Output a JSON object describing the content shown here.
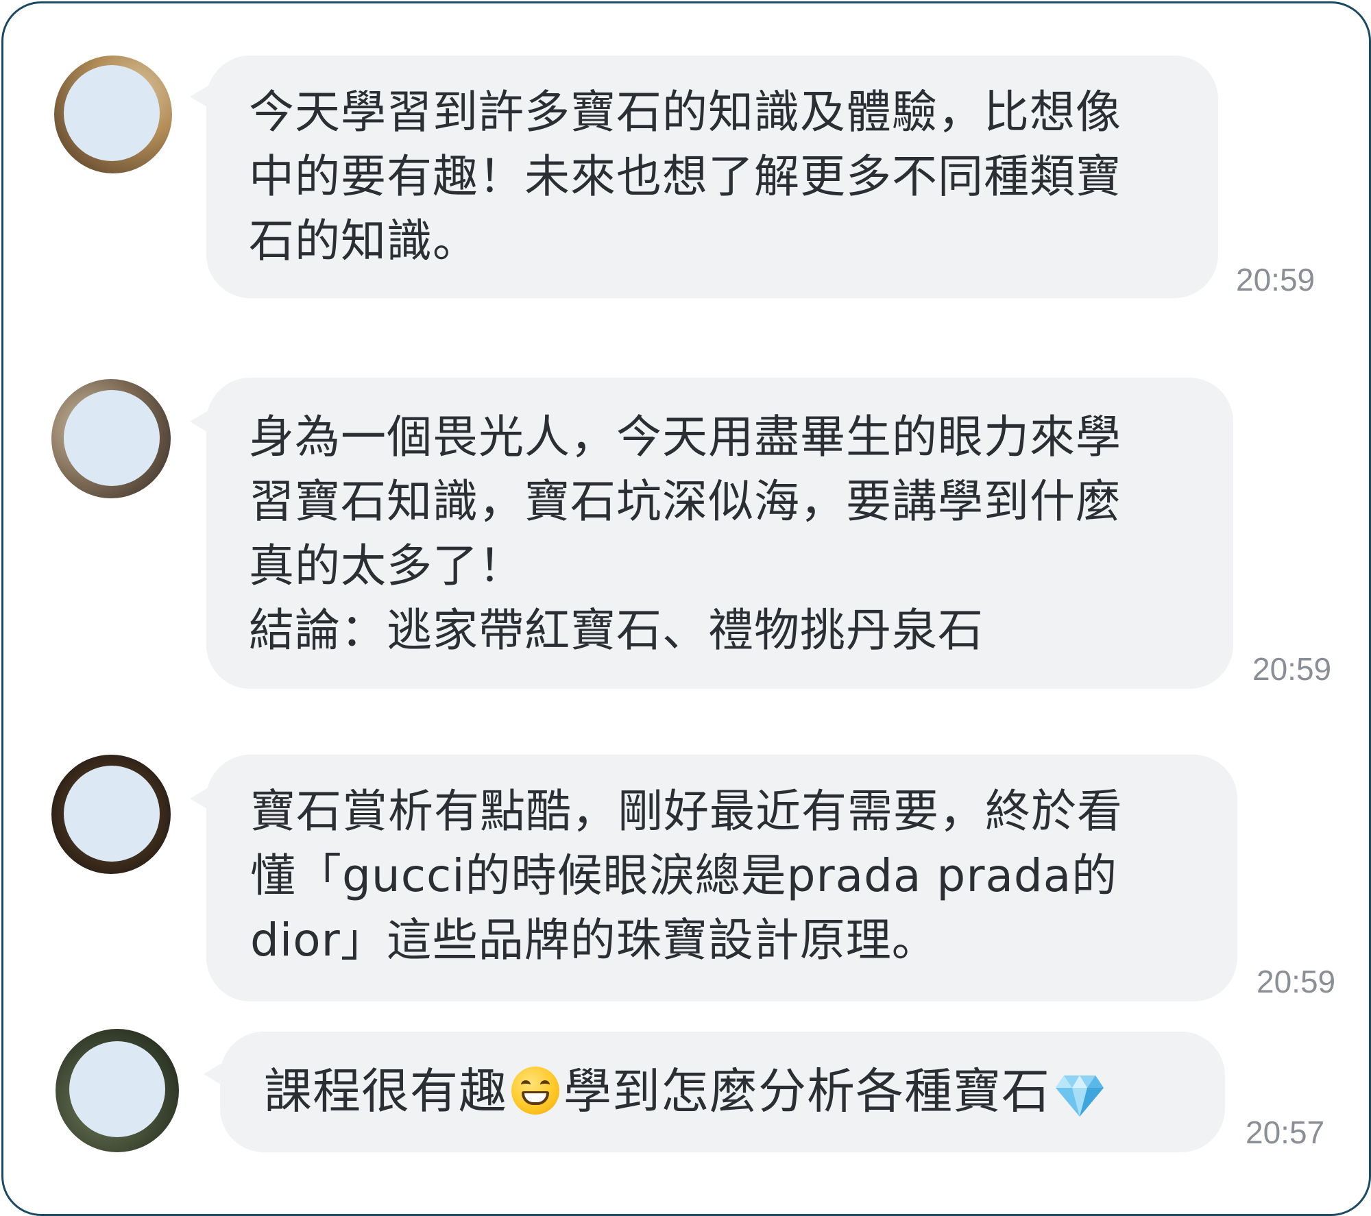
{
  "messages": [
    {
      "avatar_icon": "avatar-photo-blurred",
      "text": "今天學習到許多寶石的知識及體驗，比想像\n中的要有趣！未來也想了解更多不同種類寶\n石的知識。",
      "time": "20:59"
    },
    {
      "avatar_icon": "avatar-photo-blurred",
      "text": "身為一個畏光人，今天用盡畢生的眼力來學\n習寶石知識，寶石坑深似海，要講學到什麼\n真的太多了！\n結論：逃家帶紅寶石、禮物挑丹泉石",
      "time": "20:59"
    },
    {
      "avatar_icon": "avatar-photo-blurred",
      "text": "寶石賞析有點酷，剛好最近有需要，終於看\n懂「gucci的時候眼淚總是prada prada的\ndior」這些品牌的珠寶設計原理。",
      "time": "20:59"
    },
    {
      "avatar_icon": "avatar-photo-blurred",
      "text_before": "課程很有趣",
      "emoji_1": "grinning-face-emoji",
      "text_after": "學到怎麼分析各種寶石",
      "emoji_2": "gem-stone-emoji",
      "time": "20:57"
    }
  ],
  "colors": {
    "frame_border": "#1d4a63",
    "bubble": "#f1f2f4",
    "text": "#2b2f33",
    "time": "#8a8f96",
    "avatar_mask": "#dde8f5"
  }
}
